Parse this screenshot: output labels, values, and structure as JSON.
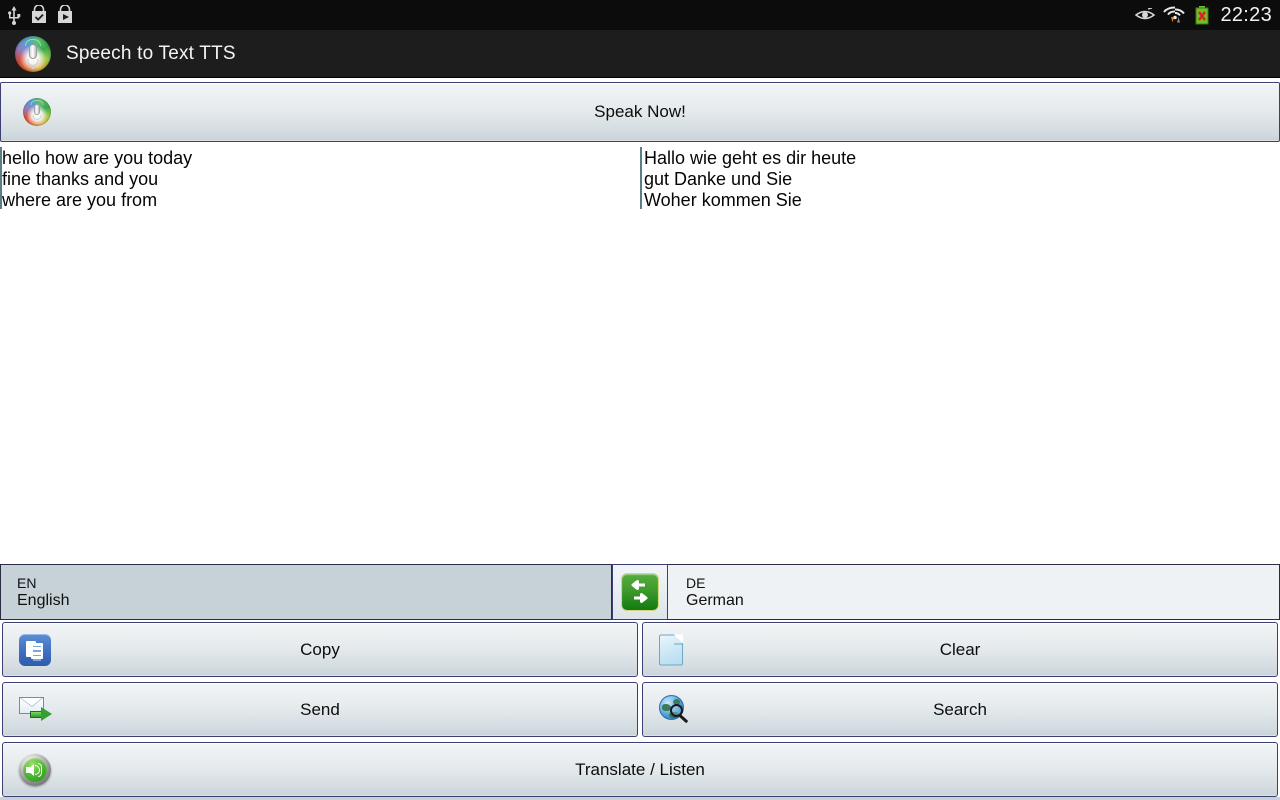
{
  "statusbar": {
    "icons_left": [
      "usb-icon",
      "app-installed-icon",
      "play-store-icon"
    ],
    "icons_right": [
      "eye-icon",
      "wifi-transfer-icon",
      "battery-error-icon"
    ],
    "time": "22:23"
  },
  "titlebar": {
    "icon": "app-mic-icon",
    "title": "Speech to Text TTS"
  },
  "speak_button": {
    "icon": "microphone-icon",
    "label": "Speak Now!"
  },
  "panes": {
    "source": {
      "icon": "text-caret",
      "text": "hello how are you today\nfine thanks and you\nwhere are you from"
    },
    "target": {
      "icon": "text-caret",
      "text": "Hallo wie geht es dir heute\ngut Danke und Sie\nWoher kommen Sie"
    }
  },
  "languages": {
    "source": {
      "code": "EN",
      "name": "English"
    },
    "swap": {
      "icon": "swap-arrows-icon",
      "label": ""
    },
    "target": {
      "code": "DE",
      "name": "German"
    }
  },
  "actions": {
    "copy": {
      "label": "Copy",
      "icon": "copy-icon"
    },
    "clear": {
      "label": "Clear",
      "icon": "page-icon"
    },
    "send": {
      "label": "Send",
      "icon": "envelope-send-icon"
    },
    "search": {
      "label": "Search",
      "icon": "globe-search-icon"
    },
    "translate": {
      "label": "Translate / Listen",
      "icon": "speaker-icon"
    }
  },
  "colors": {
    "statusbar_bg": "#0c0c0c",
    "titlebar_bg": "#1d1d1d",
    "button_border": "#3b3f72",
    "source_lang_bg": "#c6d2d8",
    "target_lang_bg": "#eef2f4",
    "swap_green": "#3f9a2c",
    "accent_blue": "#3f6fc0"
  }
}
